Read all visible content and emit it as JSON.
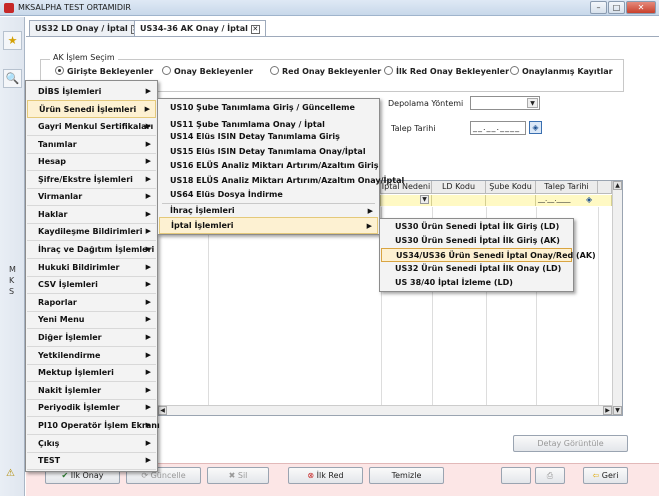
{
  "window": {
    "title": "MKSALPHA TEST ORTAMIDIR",
    "controls": [
      "–",
      "□",
      "✕"
    ]
  },
  "left_strip": {
    "tool1": "★",
    "tool2": "🔍",
    "vertical_letters": [
      "M",
      "K",
      "S"
    ],
    "warning": "⚠"
  },
  "tabs": [
    {
      "label": "US32 LD Onay / İptal",
      "close": "✕"
    },
    {
      "label": "US34-36 AK Onay / İptal",
      "close": "✕"
    }
  ],
  "ak_islem": {
    "legend": "AK İşlem Seçim",
    "options": [
      {
        "label": "Girişte Bekleyenler",
        "selected": true
      },
      {
        "label": "Onay Bekleyenler",
        "selected": false
      },
      {
        "label": "Red Onay Bekleyenler",
        "selected": false
      },
      {
        "label": "İlk Red Onay Bekleyenler",
        "selected": false
      },
      {
        "label": "Onaylanmış Kayıtlar",
        "selected": false
      }
    ]
  },
  "form": {
    "depolama_label": "Depolama Yöntemi",
    "depolama_value": "",
    "talep_label": "Talep Tarihi",
    "talep_value": "__.__.____"
  },
  "grid": {
    "columns": [
      "İptal Nedeni",
      "LD Kodu",
      "Şube Kodu",
      "Talep Tarihi"
    ],
    "filter_date": "__.__.____"
  },
  "detail_button": "Detay Görüntüle",
  "bottom_buttons": {
    "ilk_onay": "İlk Onay",
    "guncelle": "Güncelle",
    "sil": "Sil",
    "ilk_red": "İlk Red",
    "temizle": "Temizle",
    "geri": "Geri"
  },
  "main_menu": [
    {
      "label": "DİBS İşlemleri",
      "highlighted": false
    },
    {
      "label": "Ürün Senedi İşlemleri",
      "highlighted": true
    },
    {
      "label": "Gayri Menkul Sertifikaları",
      "highlighted": false
    },
    {
      "label": "Tanımlar",
      "highlighted": false
    },
    {
      "label": "Hesap",
      "highlighted": false
    },
    {
      "label": "Şifre/Ekstre İşlemleri",
      "highlighted": false
    },
    {
      "label": "Virmanlar",
      "highlighted": false
    },
    {
      "label": "Haklar",
      "highlighted": false
    },
    {
      "label": "Kaydileşme Bildirimleri",
      "highlighted": false
    },
    {
      "label": "İhraç ve Dağıtım İşlemleri",
      "highlighted": false
    },
    {
      "label": "Hukuki Bildirimler",
      "highlighted": false
    },
    {
      "label": "CSV İşlemleri",
      "highlighted": false
    },
    {
      "label": "Raporlar",
      "highlighted": false
    },
    {
      "label": "Yeni Menu",
      "highlighted": false
    },
    {
      "label": "Diğer İşlemler",
      "highlighted": false
    },
    {
      "label": "Yetkilendirme",
      "highlighted": false
    },
    {
      "label": "Mektup İşlemleri",
      "highlighted": false
    },
    {
      "label": "Nakit İşlemler",
      "highlighted": false
    },
    {
      "label": "Periyodik İşlemler",
      "highlighted": false
    },
    {
      "label": "PI10 Operatör  İşlem Ekranı",
      "highlighted": false
    },
    {
      "label": "Çıkış",
      "highlighted": false
    },
    {
      "label": "TEST",
      "highlighted": false
    }
  ],
  "sub_menu": [
    {
      "label": "US10 Şube Tanımlama Giriş / Güncelleme",
      "has_children": false,
      "highlighted": false
    },
    {
      "label": "US11 Şube Tanımlama Onay / İptal",
      "has_children": false,
      "highlighted": false
    },
    {
      "label": "US14 Elüs ISIN Detay Tanımlama Giriş",
      "has_children": false,
      "highlighted": false
    },
    {
      "label": "US15 Elüs ISIN Detay Tanımlama Onay/İptal",
      "has_children": false,
      "highlighted": false
    },
    {
      "label": "US16 ELÜS Analiz Miktarı Artırım/Azaltım Giriş",
      "has_children": false,
      "highlighted": false
    },
    {
      "label": "US18 ELÜS Analiz Miktarı Artırım/Azaltım Onay/İptal",
      "has_children": false,
      "highlighted": false
    },
    {
      "label": "US64 Elüs Dosya İndirme",
      "has_children": false,
      "highlighted": false
    },
    {
      "label": "İhraç İşlemleri",
      "has_children": true,
      "highlighted": false
    },
    {
      "label": "İptal İşlemleri",
      "has_children": true,
      "highlighted": true
    }
  ],
  "iptal_menu": [
    {
      "label": "US30 Ürün Senedi İptal İlk Giriş (LD)",
      "highlighted": false
    },
    {
      "label": "US30 Ürün Senedi İptal İlk Giriş (AK)",
      "highlighted": false
    },
    {
      "label": "US34/US36 Ürün Senedi İptal Onay/Red (AK)",
      "highlighted": true
    },
    {
      "label": "US32 Ürün Senedi İptal İlk Onay (LD)",
      "highlighted": false
    },
    {
      "label": "US 38/40 İptal İzleme (LD)",
      "highlighted": false
    }
  ]
}
